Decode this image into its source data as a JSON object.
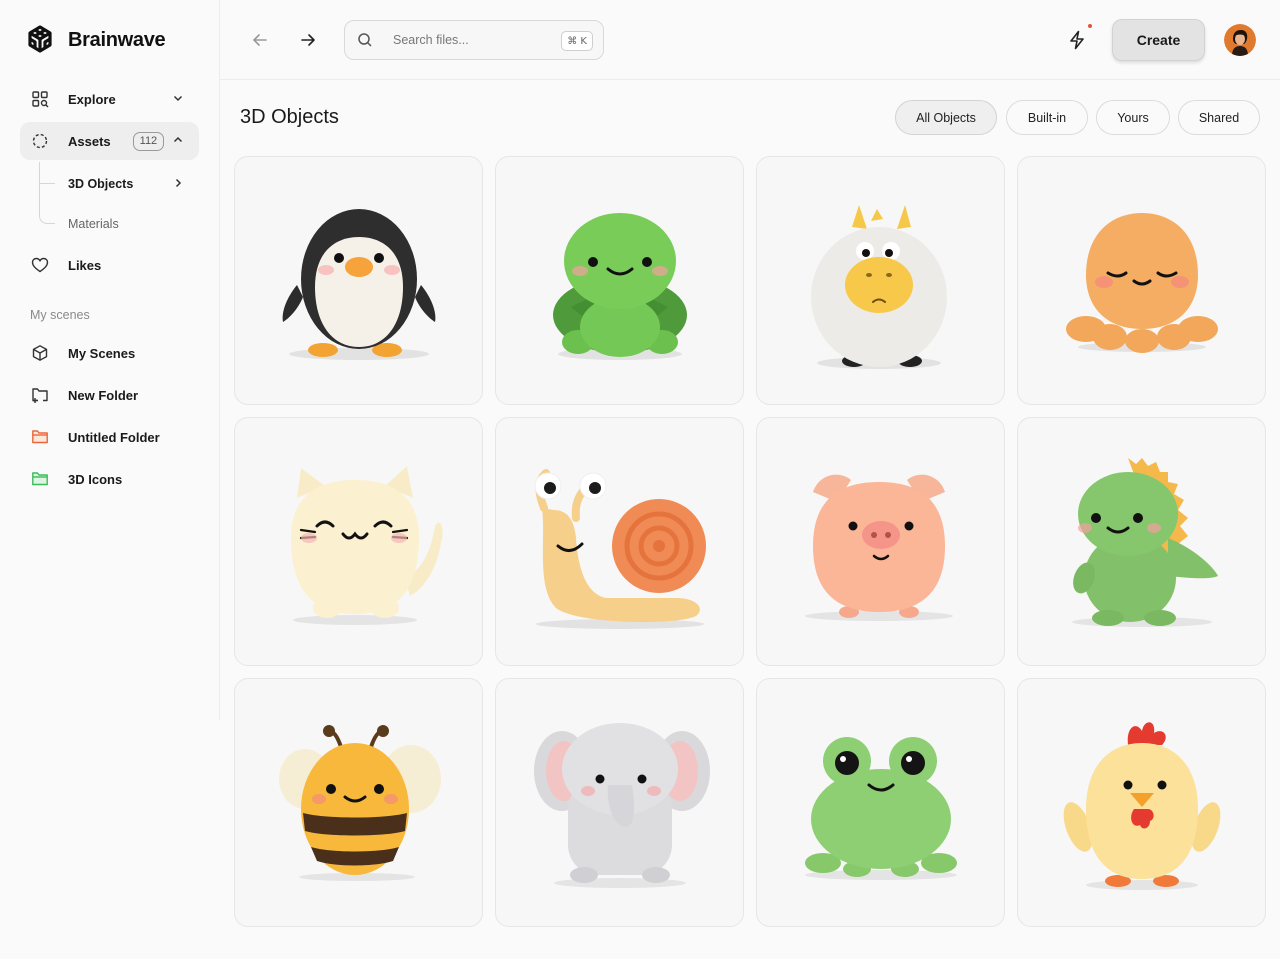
{
  "brand": {
    "name": "Brainwave"
  },
  "nav": {
    "explore": "Explore",
    "assets": "Assets",
    "assets_count": "112",
    "sub_3d_objects": "3D Objects",
    "sub_materials": "Materials",
    "likes": "Likes"
  },
  "scenes": {
    "section_label": "My scenes",
    "items": [
      "My Scenes",
      "New Folder",
      "Untitled Folder",
      "3D Icons"
    ]
  },
  "search": {
    "placeholder": "Search files...",
    "shortcut": "⌘ K"
  },
  "header": {
    "create_label": "Create"
  },
  "page": {
    "title": "3D Objects"
  },
  "filters": [
    "All Objects",
    "Built-in",
    "Yours",
    "Shared"
  ],
  "active_filter": "All Objects",
  "objects": [
    "penguin",
    "turtle",
    "horse",
    "octopus",
    "cat",
    "snail",
    "pig",
    "dinosaur",
    "bee",
    "elephant",
    "frog",
    "chick"
  ],
  "colors": {
    "accent_folder_orange": "#e8683a",
    "accent_folder_green": "#3dbb5b",
    "notification_dot": "#e5533a"
  }
}
